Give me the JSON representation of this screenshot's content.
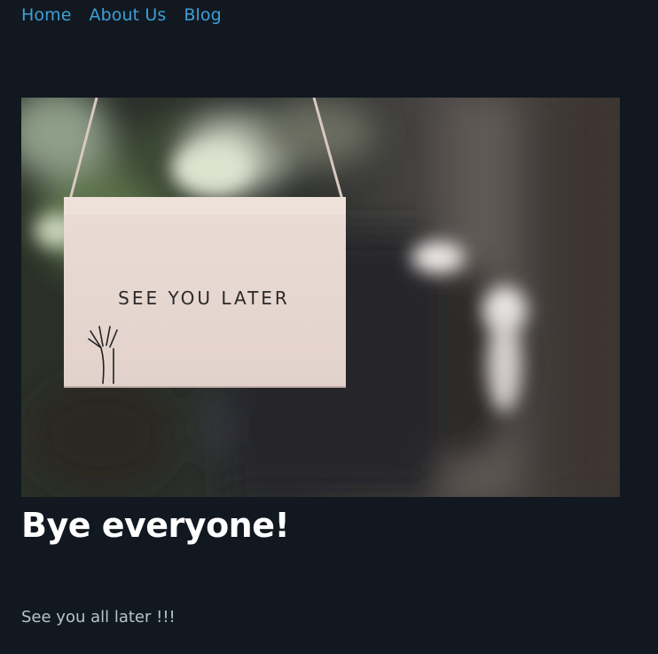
{
  "nav": {
    "items": [
      {
        "label": "Home"
      },
      {
        "label": "About Us"
      },
      {
        "label": "Blog"
      }
    ]
  },
  "hero": {
    "sign_text": "SEE YOU LATER",
    "icon": "waving-hand-icon"
  },
  "post": {
    "title": "Bye everyone!",
    "body": "See you all later !!!"
  },
  "colors": {
    "background": "#111820",
    "link": "#3e9fd6",
    "title": "#ffffff",
    "body_text": "#b9c2cb"
  }
}
